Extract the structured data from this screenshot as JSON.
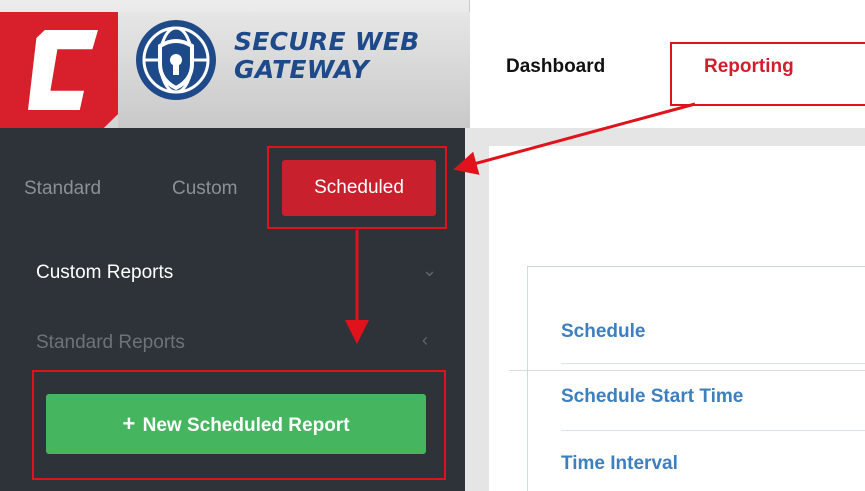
{
  "header": {
    "logo_line1": "SECURE WEB",
    "logo_line2": "GATEWAY"
  },
  "top_nav": {
    "tabs": [
      {
        "label": "Dashboard"
      },
      {
        "label": "Reporting"
      }
    ],
    "active": "Reporting"
  },
  "sidebar": {
    "sub_tabs": [
      {
        "label": "Standard"
      },
      {
        "label": "Custom"
      },
      {
        "label": "Scheduled"
      }
    ],
    "active_sub_tab": "Scheduled",
    "items": [
      {
        "label": "Custom Reports",
        "chevron": "⌄"
      },
      {
        "label": "Standard Reports",
        "chevron": "‹"
      }
    ],
    "new_button": {
      "icon": "+",
      "label": "New Scheduled Report"
    }
  },
  "main": {
    "fields": [
      {
        "label": "Schedule"
      },
      {
        "label": "Schedule Start Time"
      },
      {
        "label": "Time Interval"
      }
    ]
  },
  "colors": {
    "brand_red": "#d81f2c",
    "sidebar_bg": "#2d3339",
    "button_green": "#45b65f",
    "link_blue": "#3d7fbf",
    "annotation_red": "#e0131c"
  }
}
